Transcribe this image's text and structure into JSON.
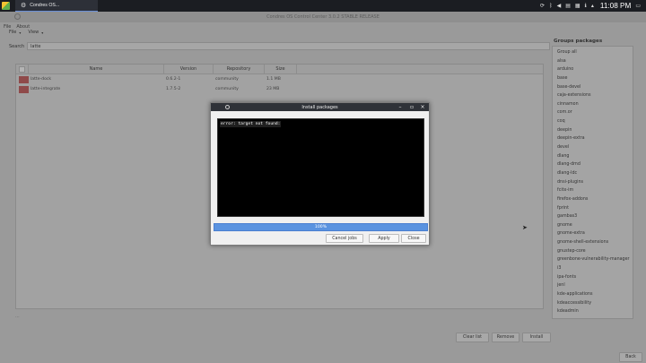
{
  "taskbar": {
    "task_label": "Condres OS...",
    "clock": "11:08 PM"
  },
  "window": {
    "title": "Condres OS Control Center 3.0.2 STABLE RELEASE",
    "menu": [
      "File",
      "About"
    ]
  },
  "toolbar": {
    "file": "File",
    "view": "View"
  },
  "search": {
    "label": "Search",
    "value": "latte"
  },
  "table": {
    "headers": [
      "Name",
      "Version",
      "Repository",
      "Size"
    ],
    "rows": [
      {
        "name": "latte-dock",
        "version": "0.6.2-1",
        "repo": "community",
        "size": "1.1 MB"
      },
      {
        "name": "latte-integrate",
        "version": "1.7.5-2",
        "repo": "community",
        "size": "23 MB"
      }
    ],
    "footer_mark": "..."
  },
  "groups": {
    "title": "Groups packages",
    "items": [
      "Group all",
      "alsa",
      "arduino",
      "base",
      "base-devel",
      "caja-extensions",
      "cinnamon",
      "com.or",
      "coq",
      "deepin",
      "deepin-extra",
      "devel",
      "dlang",
      "dlang-dmd",
      "dlang-ldc",
      "dnsi-plugins",
      "fcitx-im",
      "firefox-addons",
      "fprint",
      "gambas3",
      "gnome",
      "gnome-extra",
      "gnome-shell-extensions",
      "gnustep-core",
      "greenbone-vulnerability-manager",
      "i3",
      "ipa-fonts",
      "jenl",
      "kde-applications",
      "kdeaccessibility",
      "kdeadmin"
    ]
  },
  "buttons": {
    "clear_list": "Clear list",
    "remove": "Remove",
    "install": "Install",
    "back": "Back"
  },
  "dialog": {
    "title": "Install packages",
    "console_text": "error: target not found:",
    "progress_label": "100%",
    "progress_value": 1.0,
    "cancel_jobs": "Cancel jobs",
    "apply": "Apply",
    "close": "Close"
  },
  "colors": {
    "progress": "#5a93e0",
    "marker": "#8f4a4a"
  }
}
